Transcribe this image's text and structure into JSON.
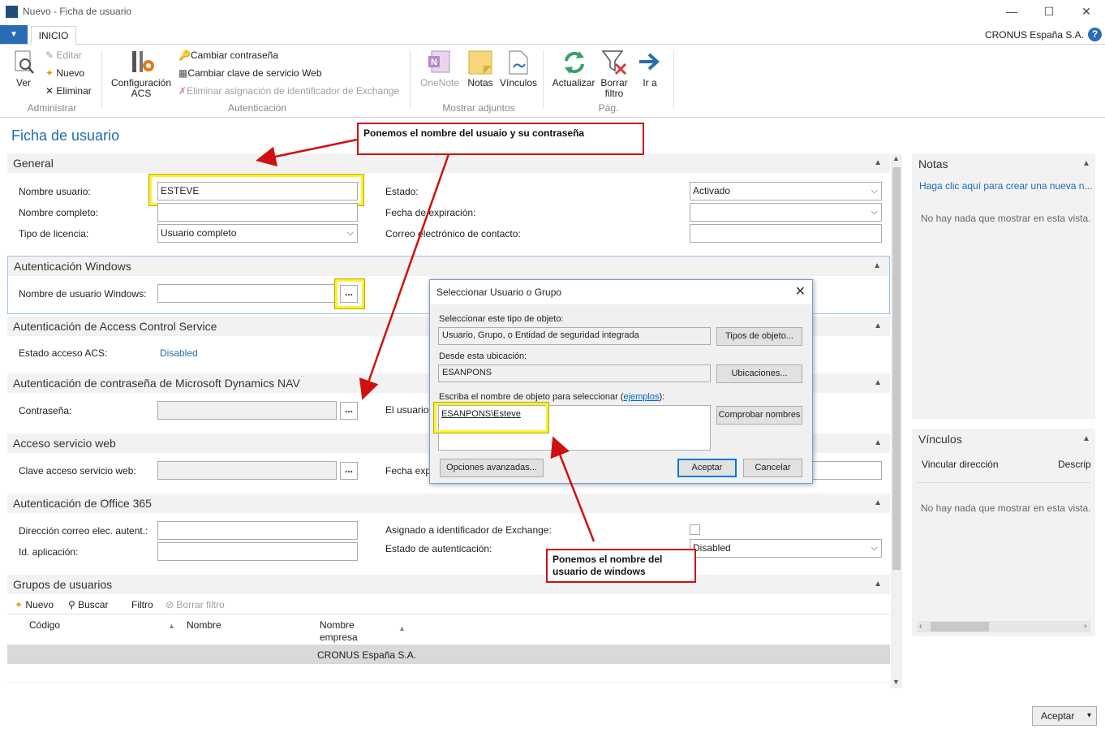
{
  "window": {
    "title": "Nuevo - Ficha de usuario",
    "minimize": "—",
    "maximize": "☐",
    "close": "✕"
  },
  "ribbon": {
    "menu_arrow": "▼",
    "tab": "INICIO",
    "company": "CRONUS España S.A.",
    "help": "?",
    "ver": "Ver",
    "editar": "Editar",
    "nuevo": "Nuevo",
    "eliminar": "Eliminar",
    "grp_administrar": "Administrar",
    "config_acs": "Configuración ACS",
    "cambiar_contrasena": "Cambiar contraseña",
    "cambiar_clave": "Cambiar clave de servicio Web",
    "eliminar_asignacion": "Eliminar asignación de identificador de Exchange",
    "grp_autenticacion": "Autenticación",
    "onenote": "OneNote",
    "notas": "Notas",
    "vinculos": "Vínculos",
    "grp_adjuntos": "Mostrar adjuntos",
    "actualizar": "Actualizar",
    "borrar_filtro": "Borrar filtro",
    "ir_a": "Ir a",
    "grp_pag": "Pág."
  },
  "page": {
    "title": "Ficha de usuario"
  },
  "general": {
    "header": "General",
    "nombre_usuario_lbl": "Nombre usuario:",
    "nombre_usuario": "ESTEVE",
    "nombre_completo_lbl": "Nombre completo:",
    "nombre_completo": "",
    "tipo_licencia_lbl": "Tipo de licencia:",
    "tipo_licencia": "Usuario completo",
    "estado_lbl": "Estado:",
    "estado": "Activado",
    "fecha_exp_lbl": "Fecha de expiración:",
    "fecha_exp": "",
    "correo_lbl": "Correo electrónico de contacto:",
    "correo": ""
  },
  "windows_auth": {
    "header": "Autenticación Windows",
    "user_lbl": "Nombre de usuario Windows:",
    "user": "",
    "dots": "..."
  },
  "acs": {
    "header": "Autenticación de Access Control Service",
    "estado_lbl": "Estado acceso ACS:",
    "estado": "Disabled"
  },
  "nav_pwd": {
    "header": "Autenticación de contraseña de Microsoft Dynamics NAV",
    "pwd_lbl": "Contraseña:",
    "dots": "...",
    "right_lbl": "El usuario"
  },
  "web": {
    "header": "Acceso servicio web",
    "clave_lbl": "Clave acceso servicio web:",
    "dots": "...",
    "right_lbl": "Fecha expi"
  },
  "o365": {
    "header": "Autenticación de Office 365",
    "correo_lbl": "Dirección correo elec. autent.:",
    "app_lbl": "Id. aplicación:",
    "asignado_lbl": "Asignado a identificador de Exchange:",
    "estado_lbl": "Estado de autenticación:",
    "estado": "Disabled"
  },
  "groups": {
    "header": "Grupos de usuarios",
    "nuevo": "Nuevo",
    "buscar": "Buscar",
    "filtro": "Filtro",
    "borrar_filtro": "Borrar filtro",
    "col_codigo": "Código",
    "col_nombre": "Nombre",
    "col_empresa_1": "Nombre",
    "col_empresa_2": "empresa",
    "row_empresa": "CRONUS España S.A."
  },
  "notas": {
    "header": "Notas",
    "link": "Haga clic aquí para crear una nueva n...",
    "empty": "No hay nada que mostrar en esta vista."
  },
  "vinculos": {
    "header": "Vínculos",
    "col1": "Vincular dirección",
    "col2": "Descrip",
    "empty": "No hay nada que mostrar en esta vista."
  },
  "dialog": {
    "title": "Seleccionar Usuario o Grupo",
    "tipo_lbl": "Seleccionar este tipo de objeto:",
    "tipo": "Usuario, Grupo, o Entidad de seguridad integrada",
    "tipos_btn": "Tipos de objeto...",
    "ubic_lbl": "Desde esta ubicación:",
    "ubic": "ESANPONS",
    "ubic_btn": "Ubicaciones...",
    "nombre_lbl_a": "Escriba el nombre de objeto para seleccionar (",
    "nombre_lbl_link": "ejemplos",
    "nombre_lbl_b": "):",
    "nombre": "ESANPONS\\Esteve",
    "comprobar_btn": "Comprobar nombres",
    "avanzadas_btn": "Opciones avanzadas...",
    "aceptar_btn": "Aceptar",
    "cancelar_btn": "Cancelar"
  },
  "annotations": {
    "top": "Ponemos el nombre del usuaio y su contraseña",
    "bottom": "Ponemos el nombre del usuario de windows"
  },
  "footer": {
    "aceptar": "Aceptar"
  },
  "colors": {
    "accent": "#1f6cb0",
    "annotation_red": "#d01010",
    "highlight_yellow": "#ffef30"
  }
}
